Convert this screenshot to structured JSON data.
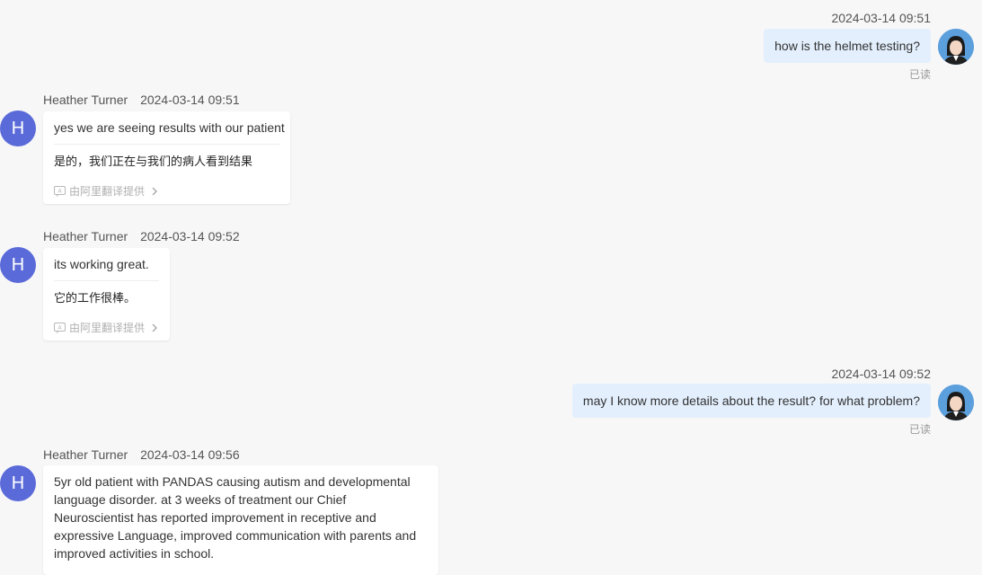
{
  "me": {
    "avatar_label": "user avatar"
  },
  "messages": [
    {
      "side": "right",
      "timestamp": "2024-03-14 09:51",
      "text": "how is the helmet testing?",
      "status": "已读"
    },
    {
      "side": "left",
      "sender": "Heather Turner",
      "avatar_letter": "H",
      "timestamp": "2024-03-14 09:51",
      "text": "yes we are seeing results with our patient",
      "translation": "是的，我们正在与我们的病人看到结果",
      "translation_credit": "由阿里翻译提供"
    },
    {
      "side": "left",
      "sender": "Heather Turner",
      "avatar_letter": "H",
      "timestamp": "2024-03-14 09:52",
      "text": "its working great.",
      "translation": "它的工作很棒。",
      "translation_credit": "由阿里翻译提供"
    },
    {
      "side": "right",
      "timestamp": "2024-03-14 09:52",
      "text": "may I know more details about the result? for what problem?",
      "status": "已读"
    },
    {
      "side": "left",
      "sender": "Heather Turner",
      "avatar_letter": "H",
      "timestamp": "2024-03-14 09:56",
      "text": "5yr old patient with PANDAS causing autism and developmental language disorder. at 3 weeks of treatment our Chief Neuroscientist has reported improvement in receptive and expressive Language, improved communication with parents and improved activities in school."
    }
  ]
}
